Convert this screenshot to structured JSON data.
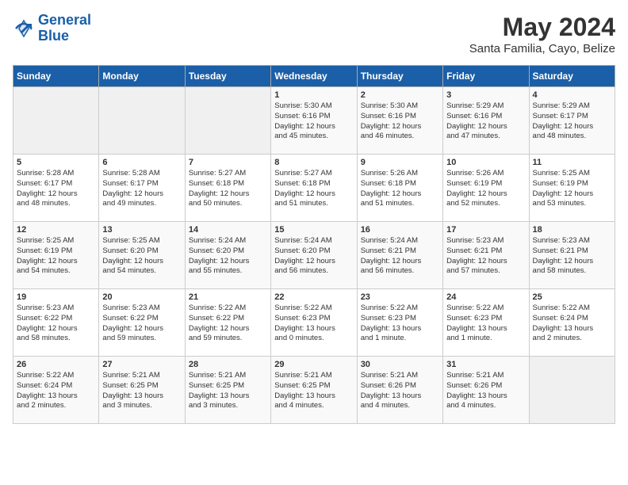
{
  "header": {
    "logo_line1": "General",
    "logo_line2": "Blue",
    "month": "May 2024",
    "location": "Santa Familia, Cayo, Belize"
  },
  "weekdays": [
    "Sunday",
    "Monday",
    "Tuesday",
    "Wednesday",
    "Thursday",
    "Friday",
    "Saturday"
  ],
  "weeks": [
    [
      {
        "day": "",
        "content": ""
      },
      {
        "day": "",
        "content": ""
      },
      {
        "day": "",
        "content": ""
      },
      {
        "day": "1",
        "content": "Sunrise: 5:30 AM\nSunset: 6:16 PM\nDaylight: 12 hours\nand 45 minutes."
      },
      {
        "day": "2",
        "content": "Sunrise: 5:30 AM\nSunset: 6:16 PM\nDaylight: 12 hours\nand 46 minutes."
      },
      {
        "day": "3",
        "content": "Sunrise: 5:29 AM\nSunset: 6:16 PM\nDaylight: 12 hours\nand 47 minutes."
      },
      {
        "day": "4",
        "content": "Sunrise: 5:29 AM\nSunset: 6:17 PM\nDaylight: 12 hours\nand 48 minutes."
      }
    ],
    [
      {
        "day": "5",
        "content": "Sunrise: 5:28 AM\nSunset: 6:17 PM\nDaylight: 12 hours\nand 48 minutes."
      },
      {
        "day": "6",
        "content": "Sunrise: 5:28 AM\nSunset: 6:17 PM\nDaylight: 12 hours\nand 49 minutes."
      },
      {
        "day": "7",
        "content": "Sunrise: 5:27 AM\nSunset: 6:18 PM\nDaylight: 12 hours\nand 50 minutes."
      },
      {
        "day": "8",
        "content": "Sunrise: 5:27 AM\nSunset: 6:18 PM\nDaylight: 12 hours\nand 51 minutes."
      },
      {
        "day": "9",
        "content": "Sunrise: 5:26 AM\nSunset: 6:18 PM\nDaylight: 12 hours\nand 51 minutes."
      },
      {
        "day": "10",
        "content": "Sunrise: 5:26 AM\nSunset: 6:19 PM\nDaylight: 12 hours\nand 52 minutes."
      },
      {
        "day": "11",
        "content": "Sunrise: 5:25 AM\nSunset: 6:19 PM\nDaylight: 12 hours\nand 53 minutes."
      }
    ],
    [
      {
        "day": "12",
        "content": "Sunrise: 5:25 AM\nSunset: 6:19 PM\nDaylight: 12 hours\nand 54 minutes."
      },
      {
        "day": "13",
        "content": "Sunrise: 5:25 AM\nSunset: 6:20 PM\nDaylight: 12 hours\nand 54 minutes."
      },
      {
        "day": "14",
        "content": "Sunrise: 5:24 AM\nSunset: 6:20 PM\nDaylight: 12 hours\nand 55 minutes."
      },
      {
        "day": "15",
        "content": "Sunrise: 5:24 AM\nSunset: 6:20 PM\nDaylight: 12 hours\nand 56 minutes."
      },
      {
        "day": "16",
        "content": "Sunrise: 5:24 AM\nSunset: 6:21 PM\nDaylight: 12 hours\nand 56 minutes."
      },
      {
        "day": "17",
        "content": "Sunrise: 5:23 AM\nSunset: 6:21 PM\nDaylight: 12 hours\nand 57 minutes."
      },
      {
        "day": "18",
        "content": "Sunrise: 5:23 AM\nSunset: 6:21 PM\nDaylight: 12 hours\nand 58 minutes."
      }
    ],
    [
      {
        "day": "19",
        "content": "Sunrise: 5:23 AM\nSunset: 6:22 PM\nDaylight: 12 hours\nand 58 minutes."
      },
      {
        "day": "20",
        "content": "Sunrise: 5:23 AM\nSunset: 6:22 PM\nDaylight: 12 hours\nand 59 minutes."
      },
      {
        "day": "21",
        "content": "Sunrise: 5:22 AM\nSunset: 6:22 PM\nDaylight: 12 hours\nand 59 minutes."
      },
      {
        "day": "22",
        "content": "Sunrise: 5:22 AM\nSunset: 6:23 PM\nDaylight: 13 hours\nand 0 minutes."
      },
      {
        "day": "23",
        "content": "Sunrise: 5:22 AM\nSunset: 6:23 PM\nDaylight: 13 hours\nand 1 minute."
      },
      {
        "day": "24",
        "content": "Sunrise: 5:22 AM\nSunset: 6:23 PM\nDaylight: 13 hours\nand 1 minute."
      },
      {
        "day": "25",
        "content": "Sunrise: 5:22 AM\nSunset: 6:24 PM\nDaylight: 13 hours\nand 2 minutes."
      }
    ],
    [
      {
        "day": "26",
        "content": "Sunrise: 5:22 AM\nSunset: 6:24 PM\nDaylight: 13 hours\nand 2 minutes."
      },
      {
        "day": "27",
        "content": "Sunrise: 5:21 AM\nSunset: 6:25 PM\nDaylight: 13 hours\nand 3 minutes."
      },
      {
        "day": "28",
        "content": "Sunrise: 5:21 AM\nSunset: 6:25 PM\nDaylight: 13 hours\nand 3 minutes."
      },
      {
        "day": "29",
        "content": "Sunrise: 5:21 AM\nSunset: 6:25 PM\nDaylight: 13 hours\nand 4 minutes."
      },
      {
        "day": "30",
        "content": "Sunrise: 5:21 AM\nSunset: 6:26 PM\nDaylight: 13 hours\nand 4 minutes."
      },
      {
        "day": "31",
        "content": "Sunrise: 5:21 AM\nSunset: 6:26 PM\nDaylight: 13 hours\nand 4 minutes."
      },
      {
        "day": "",
        "content": ""
      }
    ]
  ]
}
